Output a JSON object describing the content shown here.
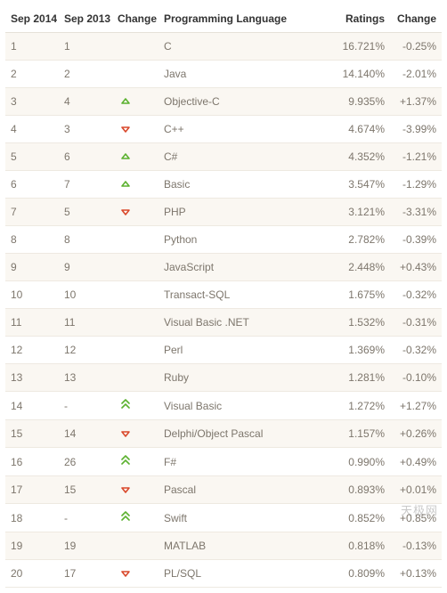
{
  "chart_data": {
    "type": "table",
    "title": "",
    "columns": [
      "Sep 2014",
      "Sep 2013",
      "Change",
      "Programming Language",
      "Ratings",
      "Change"
    ],
    "rows": [
      {
        "rank2014": "1",
        "rank2013": "1",
        "move": "",
        "language": "C",
        "ratings": "16.721%",
        "delta": "-0.25%"
      },
      {
        "rank2014": "2",
        "rank2013": "2",
        "move": "",
        "language": "Java",
        "ratings": "14.140%",
        "delta": "-2.01%"
      },
      {
        "rank2014": "3",
        "rank2013": "4",
        "move": "up",
        "language": "Objective-C",
        "ratings": "9.935%",
        "delta": "+1.37%"
      },
      {
        "rank2014": "4",
        "rank2013": "3",
        "move": "down",
        "language": "C++",
        "ratings": "4.674%",
        "delta": "-3.99%"
      },
      {
        "rank2014": "5",
        "rank2013": "6",
        "move": "up",
        "language": "C#",
        "ratings": "4.352%",
        "delta": "-1.21%"
      },
      {
        "rank2014": "6",
        "rank2013": "7",
        "move": "up",
        "language": "Basic",
        "ratings": "3.547%",
        "delta": "-1.29%"
      },
      {
        "rank2014": "7",
        "rank2013": "5",
        "move": "down",
        "language": "PHP",
        "ratings": "3.121%",
        "delta": "-3.31%"
      },
      {
        "rank2014": "8",
        "rank2013": "8",
        "move": "",
        "language": "Python",
        "ratings": "2.782%",
        "delta": "-0.39%"
      },
      {
        "rank2014": "9",
        "rank2013": "9",
        "move": "",
        "language": "JavaScript",
        "ratings": "2.448%",
        "delta": "+0.43%"
      },
      {
        "rank2014": "10",
        "rank2013": "10",
        "move": "",
        "language": "Transact-SQL",
        "ratings": "1.675%",
        "delta": "-0.32%"
      },
      {
        "rank2014": "11",
        "rank2013": "11",
        "move": "",
        "language": "Visual Basic .NET",
        "ratings": "1.532%",
        "delta": "-0.31%"
      },
      {
        "rank2014": "12",
        "rank2013": "12",
        "move": "",
        "language": "Perl",
        "ratings": "1.369%",
        "delta": "-0.32%"
      },
      {
        "rank2014": "13",
        "rank2013": "13",
        "move": "",
        "language": "Ruby",
        "ratings": "1.281%",
        "delta": "-0.10%"
      },
      {
        "rank2014": "14",
        "rank2013": "-",
        "move": "double-up",
        "language": "Visual Basic",
        "ratings": "1.272%",
        "delta": "+1.27%"
      },
      {
        "rank2014": "15",
        "rank2013": "14",
        "move": "down",
        "language": "Delphi/Object Pascal",
        "ratings": "1.157%",
        "delta": "+0.26%"
      },
      {
        "rank2014": "16",
        "rank2013": "26",
        "move": "double-up",
        "language": "F#",
        "ratings": "0.990%",
        "delta": "+0.49%"
      },
      {
        "rank2014": "17",
        "rank2013": "15",
        "move": "down",
        "language": "Pascal",
        "ratings": "0.893%",
        "delta": "+0.01%"
      },
      {
        "rank2014": "18",
        "rank2013": "-",
        "move": "double-up",
        "language": "Swift",
        "ratings": "0.852%",
        "delta": "+0.85%"
      },
      {
        "rank2014": "19",
        "rank2013": "19",
        "move": "",
        "language": "MATLAB",
        "ratings": "0.818%",
        "delta": "-0.13%"
      },
      {
        "rank2014": "20",
        "rank2013": "17",
        "move": "down",
        "language": "PL/SQL",
        "ratings": "0.809%",
        "delta": "+0.13%"
      }
    ]
  },
  "watermark": "天极网"
}
